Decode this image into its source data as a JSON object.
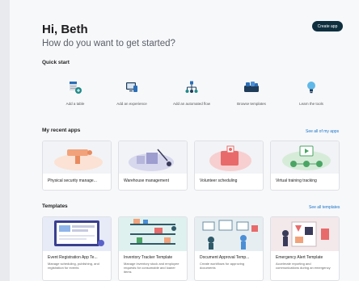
{
  "header": {
    "greeting": "Hi, Beth",
    "subtitle": "How do you want to get started?",
    "create_app": "Create app"
  },
  "quick_start": {
    "title": "Quick start",
    "items": [
      {
        "label": "Add a table",
        "icon": "table-add-icon"
      },
      {
        "label": "Add an experience",
        "icon": "experience-icon"
      },
      {
        "label": "Add an automated flow",
        "icon": "flow-icon"
      },
      {
        "label": "Browse templates",
        "icon": "templates-icon"
      },
      {
        "label": "Learn the tools",
        "icon": "lightbulb-icon"
      }
    ]
  },
  "recent_apps": {
    "title": "My recent apps",
    "see_all": "See all of my apps",
    "items": [
      {
        "name": "Physical security manage..."
      },
      {
        "name": "Warehouse management"
      },
      {
        "name": "Volunteer scheduling"
      },
      {
        "name": "Virtual training tracking"
      }
    ]
  },
  "templates": {
    "title": "Templates",
    "see_all": "See all templates",
    "items": [
      {
        "name": "Event Registration App Te...",
        "desc": "Manage scheduling, publishing, and registration for events"
      },
      {
        "name": "Inventory Tracker Template",
        "desc": "Manage inventory stock and employee requests for consumable and loaner items"
      },
      {
        "name": "Document Approval Temp...",
        "desc": "Create workflows for approving documents"
      },
      {
        "name": "Emergency Alert Template",
        "desc": "Accelerate reporting and communications during an emergency"
      }
    ]
  },
  "colors": {
    "accent": "#1a73c8",
    "button": "#0f2f3f",
    "icon_blue": "#2a6fb8",
    "icon_teal": "#1f8a8a",
    "app_green": "#4aa564",
    "app_orange": "#f2a27a",
    "app_purple": "#b6b6dc",
    "app_red": "#e86a6a"
  }
}
